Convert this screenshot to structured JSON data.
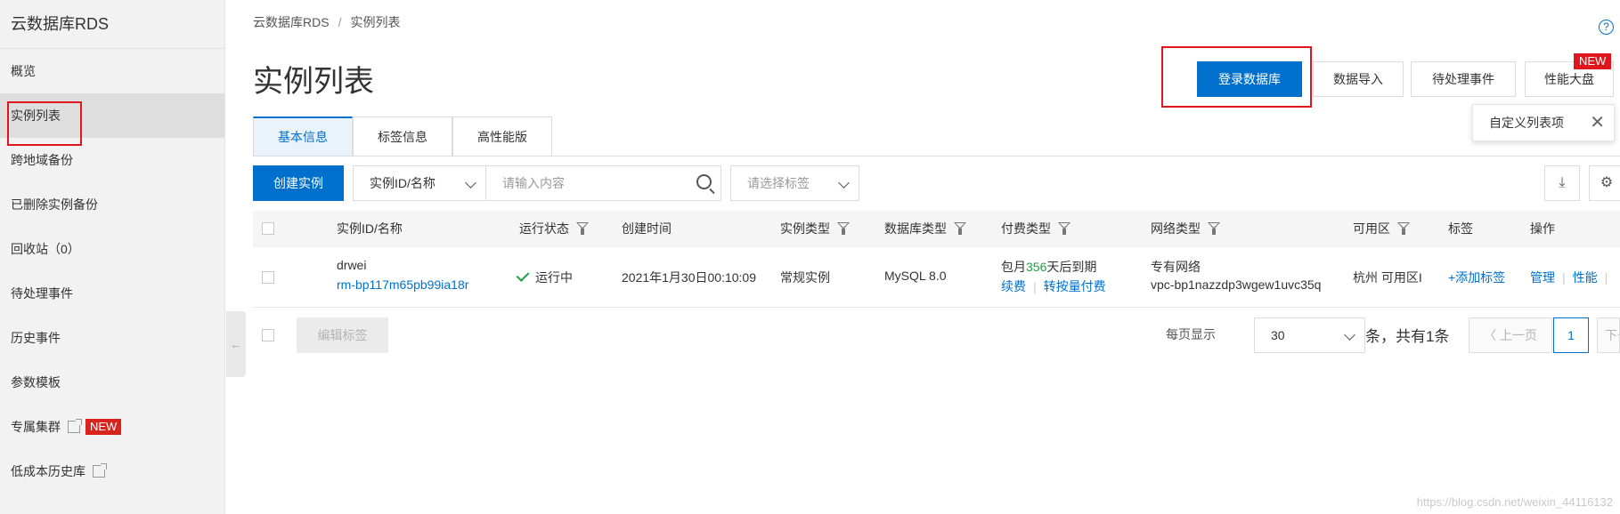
{
  "sidebar": {
    "title": "云数据库RDS",
    "items": [
      {
        "label": "概览"
      },
      {
        "label": "实例列表"
      },
      {
        "label": "跨地域备份"
      },
      {
        "label": "已删除实例备份"
      },
      {
        "label": "回收站（0）"
      },
      {
        "label": "待处理事件"
      },
      {
        "label": "历史事件"
      },
      {
        "label": "参数模板"
      },
      {
        "label": "专属集群",
        "badge": "NEW"
      },
      {
        "label": "低成本历史库"
      }
    ],
    "collapse_icon": "arrow-left-icon"
  },
  "breadcrumb": {
    "root": "云数据库RDS",
    "sep": "/",
    "current": "实例列表"
  },
  "page_title": "实例列表",
  "header_buttons": {
    "login_db": "登录数据库",
    "data_import": "数据导入",
    "pending_events": "待处理事件",
    "performance": "性能大盘",
    "new_flag": "NEW"
  },
  "customize_popup": {
    "label": "自定义列表项",
    "close": "✕"
  },
  "tabs": [
    "基本信息",
    "标签信息",
    "高性能版"
  ],
  "toolbar": {
    "create_instance": "创建实例",
    "filter_select": "实例ID/名称",
    "search_placeholder": "请输入内容",
    "tag_placeholder": "请选择标签"
  },
  "table": {
    "columns": [
      "实例ID/名称",
      "运行状态",
      "创建时间",
      "实例类型",
      "数据库类型",
      "付费类型",
      "网络类型",
      "可用区",
      "标签",
      "操作"
    ],
    "rows": [
      {
        "name": "drwei",
        "id": "rm-bp117m65pb99ia18r",
        "status": "运行中",
        "created": "2021年1月30日00:10:09",
        "instance_type": "常规实例",
        "db_type": "MySQL 8.0",
        "billing_prefix": "包月",
        "billing_days": "356",
        "billing_suffix": "天后到期",
        "renew": "续费",
        "to_payg": "转按量付费",
        "network": "专有网络",
        "vpc": "vpc-bp1nazzdp3wgew1uvc35q",
        "zone": "杭州 可用区I",
        "add_tag": "+添加标签",
        "op_manage": "管理",
        "op_perf": "性能"
      }
    ]
  },
  "footer": {
    "edit_tags": "编辑标签",
    "per_page_label": "每页显示",
    "per_page_value": "30",
    "total": "条，共有1条",
    "prev": "上一页",
    "page": "1",
    "next": "下一"
  },
  "watermark": "https://blog.csdn.net/weixin_44116132"
}
